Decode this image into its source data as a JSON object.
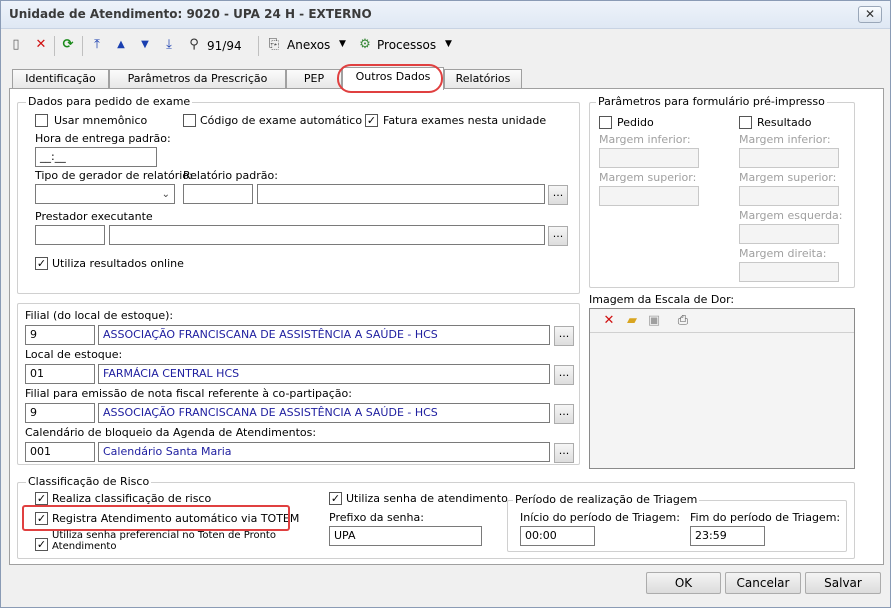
{
  "window": {
    "title": "Unidade de Atendimento: 9020 - UPA 24 H - EXTERNO",
    "close": "✕"
  },
  "toolbar": {
    "record_position": "91/94",
    "anexos_label": "Anexos",
    "processos_label": "Processos"
  },
  "tabs": [
    {
      "label": "Identificação"
    },
    {
      "label": "Parâmetros da Prescrição"
    },
    {
      "label": "PEP"
    },
    {
      "label": "Outros Dados"
    },
    {
      "label": "Relatórios"
    }
  ],
  "exame": {
    "group_title": "Dados para pedido de exame",
    "usar_mnemonico": "Usar mnemônico",
    "codigo_automatico": "Código de exame automático",
    "fatura_exames": "Fatura exames nesta unidade",
    "hora_label": "Hora de entrega padrão:",
    "hora_value": "__:__",
    "tipo_gerador_label": "Tipo de gerador de relatório:",
    "relatorio_padrao_label": "Relatório padrão:",
    "prestador_label": "Prestador executante",
    "utiliza_online": "Utiliza resultados online"
  },
  "formulario": {
    "group_title": "Parâmetros para formulário pré-impresso",
    "pedido": "Pedido",
    "resultado": "Resultado",
    "margem_inferior": "Margem inferior:",
    "margem_superior": "Margem superior:",
    "margem_esquerda": "Margem esquerda:",
    "margem_direita": "Margem direita:"
  },
  "estoque": {
    "filial_label": "Filial (do local de estoque):",
    "filial_code": "9",
    "filial_name": "ASSOCIAÇÃO FRANCISCANA DE ASSISTÊNCIA A SAÚDE - HCS",
    "local_label": "Local de estoque:",
    "local_code": "01",
    "local_name": "FARMÁCIA CENTRAL HCS",
    "filial_nf_label": "Filial para emissão de nota fiscal referente à co-partipação:",
    "filial_nf_code": "9",
    "filial_nf_name": "ASSOCIAÇÃO FRANCISCANA DE ASSISTÊNCIA A SAÚDE - HCS",
    "calendario_label": "Calendário de bloqueio da Agenda de Atendimentos:",
    "calendario_code": "001",
    "calendario_name": "Calendário Santa Maria"
  },
  "escala_dor": {
    "label": "Imagem da Escala de Dor:"
  },
  "risco": {
    "group_title": "Classificação de Risco",
    "realiza": "Realiza classificação de risco",
    "registra_totem": "Registra Atendimento automático via TOTEM",
    "senha_preferencial": "Utiliza senha preferencial no Toten de Pronto Atendimento",
    "utiliza_senha": "Utiliza senha de atendimento",
    "prefixo_label": "Prefixo da senha:",
    "prefixo_value": "UPA"
  },
  "triagem": {
    "group_title": "Período de realização de Triagem",
    "inicio_label": "Início do período de Triagem:",
    "inicio_value": "00:00",
    "fim_label": "Fim do período de Triagem:",
    "fim_value": "23:59"
  },
  "buttons": {
    "ok": "OK",
    "cancelar": "Cancelar",
    "salvar": "Salvar"
  },
  "colors": {
    "highlight": "#e04040",
    "link_text": "#2020a0"
  }
}
